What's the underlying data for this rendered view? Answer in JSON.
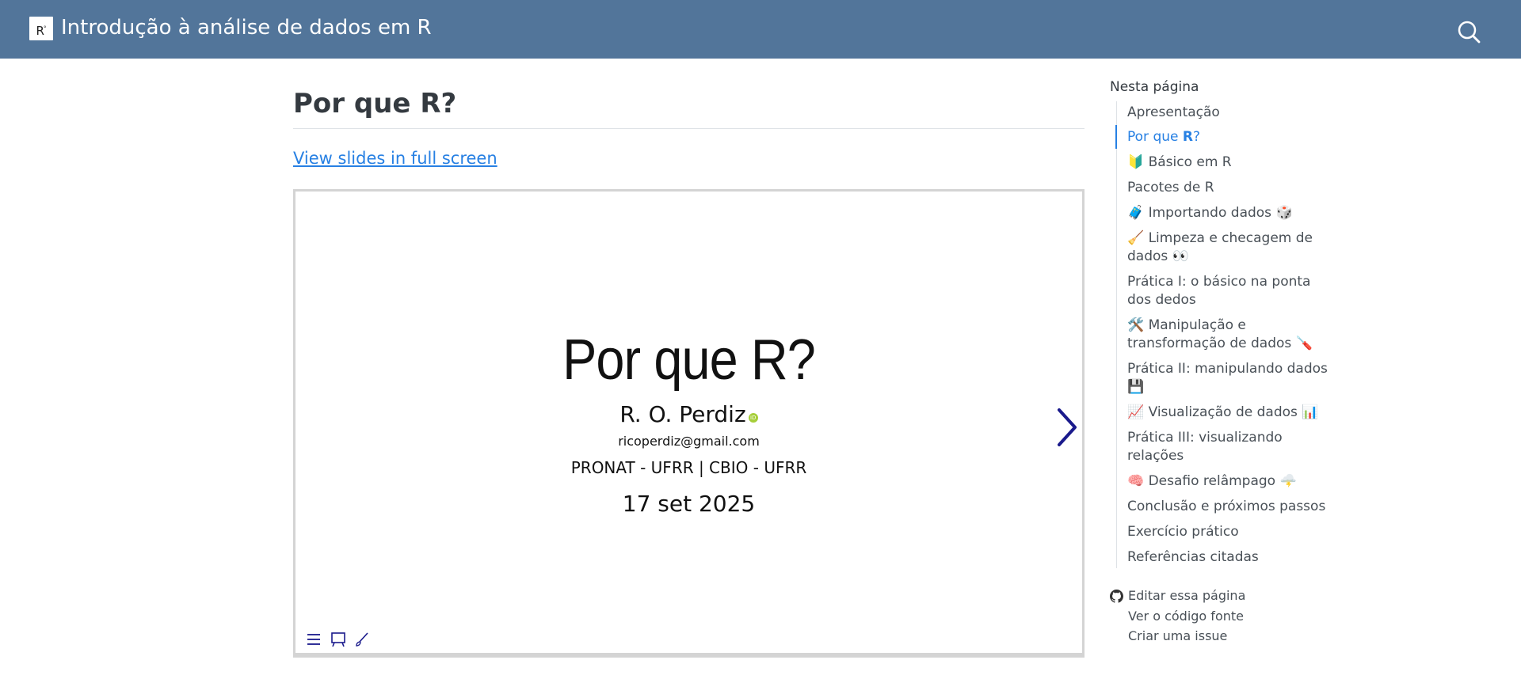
{
  "header": {
    "logo_text": "R",
    "title": "Introdução à análise de dados em R",
    "search_icon": "search-icon",
    "bg_color": "#52759a"
  },
  "main": {
    "title_prefix": "Por que ",
    "title_r": "R",
    "title_suffix": "?",
    "fullscreen_link": "View slides in full screen"
  },
  "slide": {
    "title": "Por que R?",
    "author": "R. O. Perdiz",
    "email": "ricoperdiz@gmail.com",
    "affiliation": "PRONAT - UFRR | CBIO - UFRR",
    "date": "17 set 2025",
    "tools": [
      "menu-icon",
      "chalkboard-icon",
      "brush-icon"
    ]
  },
  "toc": {
    "heading": "Nesta página",
    "items": [
      "Apresentação",
      "Por que R?",
      "🔰 Básico em R",
      "Pacotes de R",
      "🧳 Importando dados 🎲",
      "🧹 Limpeza e checagem de dados 👀",
      "Prática I: o básico na ponta dos dedos",
      "🛠️ Manipulação e transformação de dados 🪛",
      "Prática II: manipulando dados 💾",
      "📈 Visualização de dados 📊",
      "Prática III: visualizando relações",
      "🧠 Desafio relâmpago 🌩️",
      "Conclusão e próximos passos",
      "Exercício prático",
      "Referências citadas"
    ],
    "active_index": 1,
    "links": [
      "Editar essa página",
      "Ver o código fonte",
      "Criar uma issue"
    ]
  }
}
